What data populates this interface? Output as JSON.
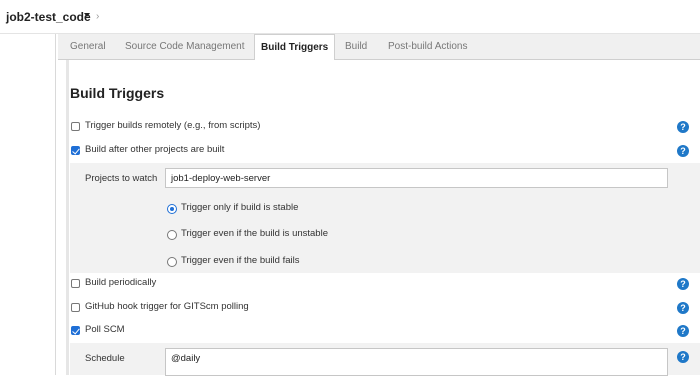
{
  "breadcrumb": {
    "job_name": "job2-test_code",
    "separator": "›"
  },
  "tabs": [
    {
      "label": "General"
    },
    {
      "label": "Source Code Management"
    },
    {
      "label": "Build Triggers"
    },
    {
      "label": "Build"
    },
    {
      "label": "Post-build Actions"
    }
  ],
  "active_tab": "Build Triggers",
  "section": {
    "title": "Build Triggers"
  },
  "triggers": [
    {
      "label": "Trigger builds remotely (e.g., from scripts)",
      "checked": false
    },
    {
      "label": "Build after other projects are built",
      "checked": true
    },
    {
      "label": "Build periodically",
      "checked": false
    },
    {
      "label": "GitHub hook trigger for GITScm polling",
      "checked": false
    },
    {
      "label": "Poll SCM",
      "checked": true
    }
  ],
  "upstream": {
    "projects_label": "Projects to watch",
    "projects_value": "job1-deploy-web-server",
    "options": [
      {
        "label": "Trigger only if build is stable",
        "selected": true
      },
      {
        "label": "Trigger even if the build is unstable",
        "selected": false
      },
      {
        "label": "Trigger even if the build fails",
        "selected": false
      }
    ]
  },
  "poll": {
    "schedule_label": "Schedule",
    "schedule_value": "@daily"
  },
  "help_icon": "?",
  "colors": {
    "accent": "#1f6fd6",
    "help": "#1f78c8",
    "nested_bg": "#f2f2f2"
  }
}
